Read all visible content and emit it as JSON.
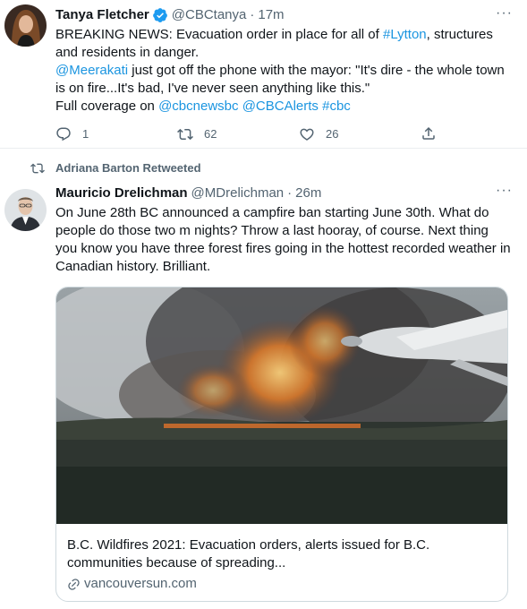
{
  "tweet1": {
    "name": "Tanya Fletcher",
    "handle": "@CBCtanya",
    "dot": "·",
    "time": "17m",
    "text": {
      "seg1": "BREAKING NEWS: Evacuation order in place for all of ",
      "seg2": "#Lytton",
      "seg3": ", structures and residents in danger.",
      "mention": "@Meerakati",
      "seg4": " just got off the phone with the mayor: \"It's dire - the whole town is on fire...It's bad, I've never seen anything like this.\"",
      "seg5": "Full coverage on ",
      "link1": "@cbcnewsbc",
      "link2": "@CBCAlerts",
      "link3": "#cbc"
    },
    "replies": "1",
    "retweets": "62",
    "likes": "26"
  },
  "tweet2": {
    "retweeted_by": "Adriana Barton Retweeted",
    "name": "Mauricio Drelichman",
    "handle": "@MDrelichman",
    "dot": "·",
    "time": "26m",
    "text": "On June 28th BC announced a campfire ban starting June 30th. What do people do those two m nights? Throw a last hooray, of course. Next thing you know you have three forest fires going in the hottest recorded weather in Canadian history. Brilliant.",
    "card": {
      "title": "B.C. Wildfires 2021: Evacuation orders, alerts issued for B.C. communities because of spreading...",
      "domain": "vancouversun.com"
    }
  },
  "colors": {
    "link": "#1b95e0",
    "secondary": "#536471",
    "verified": "#1d9bf0"
  },
  "icons": [
    "verified-badge-icon",
    "more-icon",
    "reply-icon",
    "retweet-icon",
    "like-icon",
    "share-icon",
    "link-icon"
  ]
}
